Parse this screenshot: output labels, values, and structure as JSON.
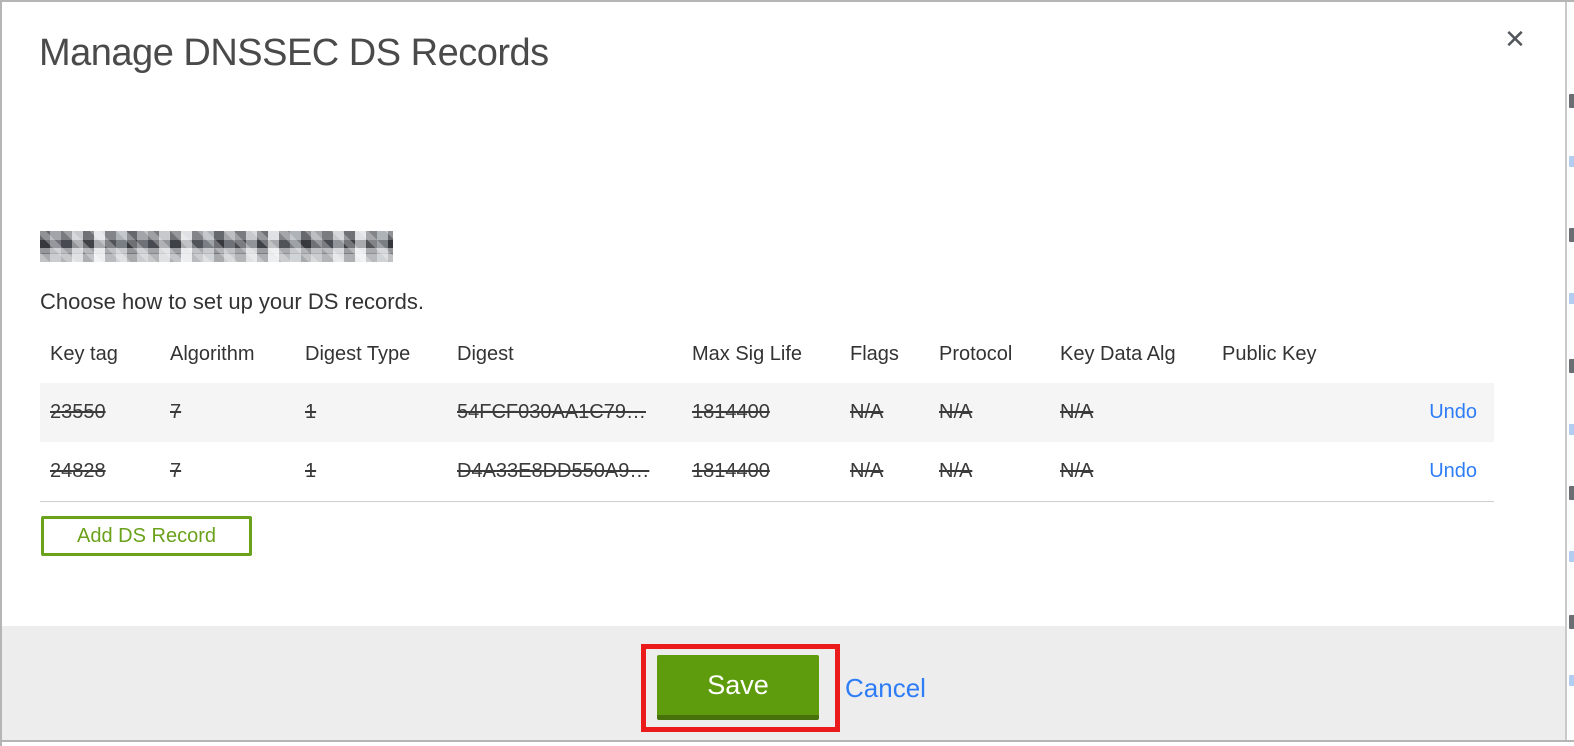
{
  "modal": {
    "title": "Manage DNSSEC DS Records",
    "close_glyph": "✕",
    "domain_redacted": true,
    "subtitle": "Choose how to set up your DS records.",
    "table": {
      "headers": [
        "Key tag",
        "Algorithm",
        "Digest Type",
        "Digest",
        "Max Sig Life",
        "Flags",
        "Protocol",
        "Key Data Alg",
        "Public Key"
      ],
      "rows": [
        {
          "cells": [
            "23550",
            "7",
            "1",
            "54FCF030AA1C79…",
            "1814400",
            "N/A",
            "N/A",
            "N/A",
            ""
          ],
          "action": "Undo",
          "struck": true
        },
        {
          "cells": [
            "24828",
            "7",
            "1",
            "D4A33E8DD550A9…",
            "1814400",
            "N/A",
            "N/A",
            "N/A",
            ""
          ],
          "action": "Undo",
          "struck": true
        }
      ]
    },
    "add_ds_record_label": "Add DS Record",
    "footer": {
      "save_label": "Save",
      "cancel_label": "Cancel"
    }
  },
  "annotation": {
    "type": "highlight-box",
    "target": "save-button",
    "color": "#ec1b1b"
  },
  "colors": {
    "save_green": "#5e9c0d",
    "save_green_dark": "#47710a",
    "add_outline_green": "#6ba21c",
    "link_blue": "#2e7df6",
    "annotation_red": "#ec1b1b",
    "footer_bg": "#ededed",
    "row_stripe_bg": "#f5f5f6"
  }
}
